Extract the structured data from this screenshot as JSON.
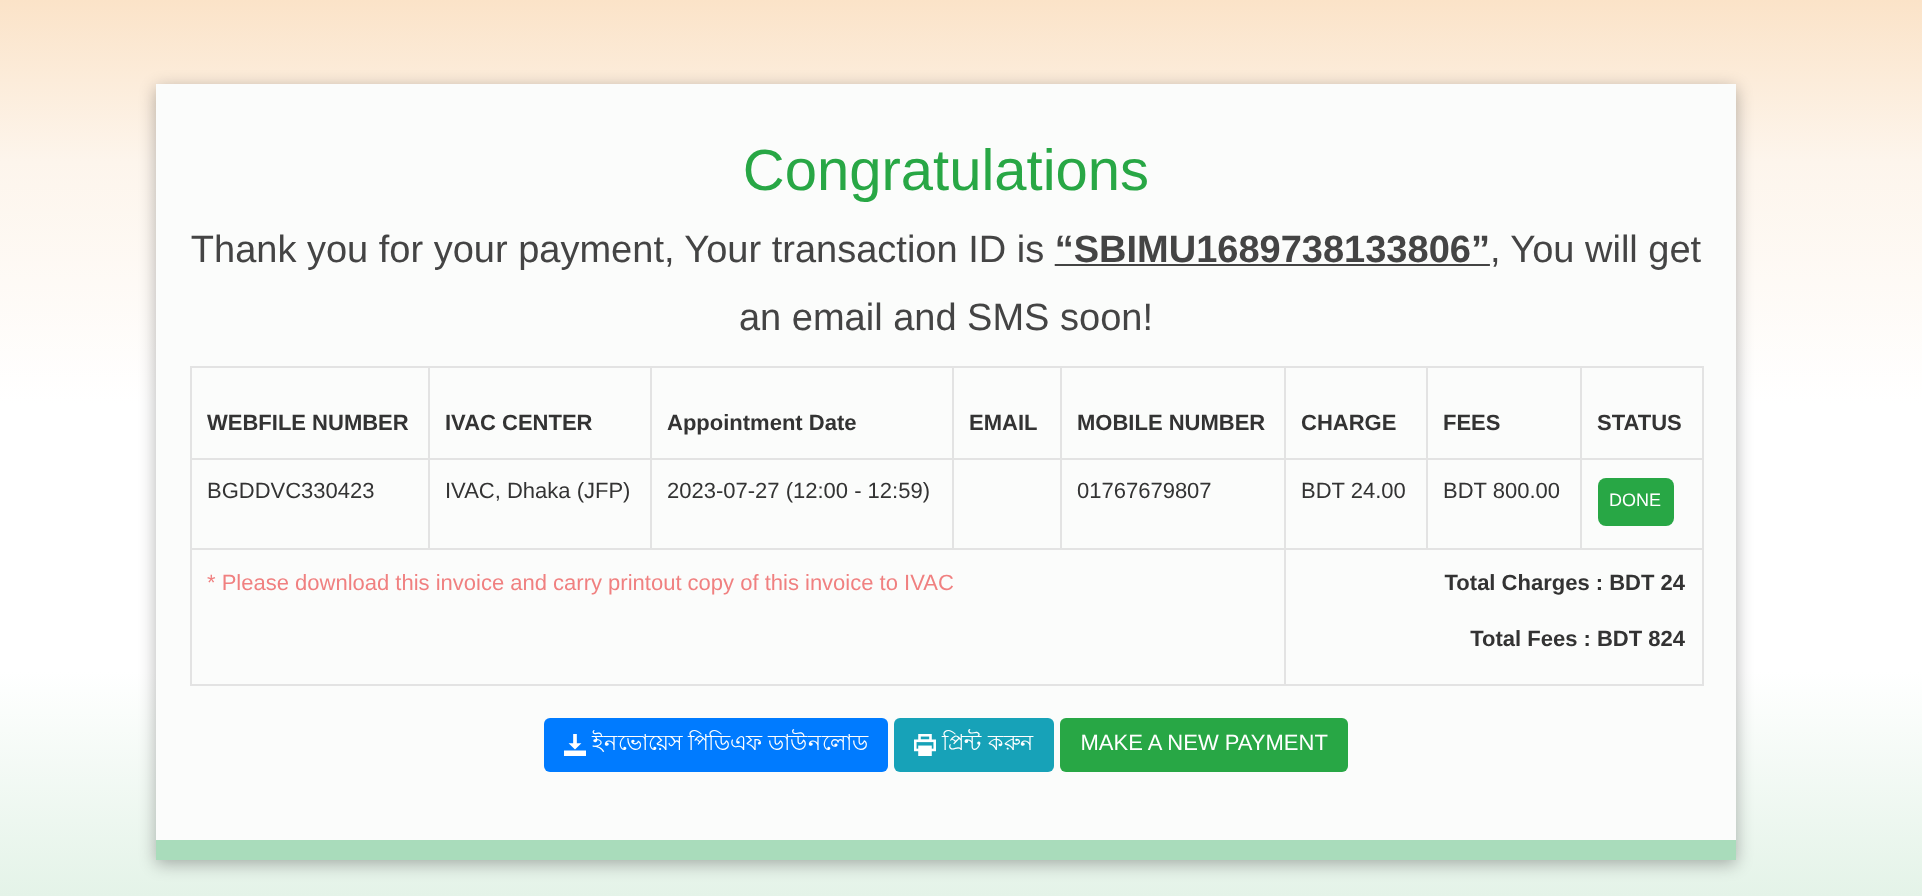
{
  "heading": "Congratulations",
  "message": {
    "before": "Thank you for your payment, Your transaction ID is ",
    "transaction_id": "“SBIMU1689738133806”",
    "after": ", You will get an email and SMS soon!"
  },
  "table": {
    "columns": [
      "WEBFILE NUMBER",
      "IVAC CENTER",
      "Appointment Date",
      "EMAIL",
      "MOBILE NUMBER",
      "CHARGE",
      "FEES",
      "STATUS"
    ],
    "rows": [
      {
        "cells": [
          "BGDDVC330423",
          "IVAC, Dhaka (JFP)",
          "2023-07-27 (12:00 - 12:59)",
          "",
          "01767679807",
          "BDT 24.00",
          "BDT 800.00"
        ],
        "status": {
          "label": "DONE",
          "kind": "success"
        }
      }
    ],
    "note": "* Please download this invoice and carry printout copy of this invoice to IVAC",
    "totals": [
      "Total Charges : BDT 24",
      "Total Fees : BDT 824"
    ]
  },
  "buttons": [
    {
      "label": "ইনভোয়েস পিডিএফ ডাউনলোড",
      "kind": "download"
    },
    {
      "label": "প্রিন্ট করুন",
      "kind": "print"
    },
    {
      "label": "MAKE A NEW PAYMENT",
      "kind": "payment"
    }
  ]
}
